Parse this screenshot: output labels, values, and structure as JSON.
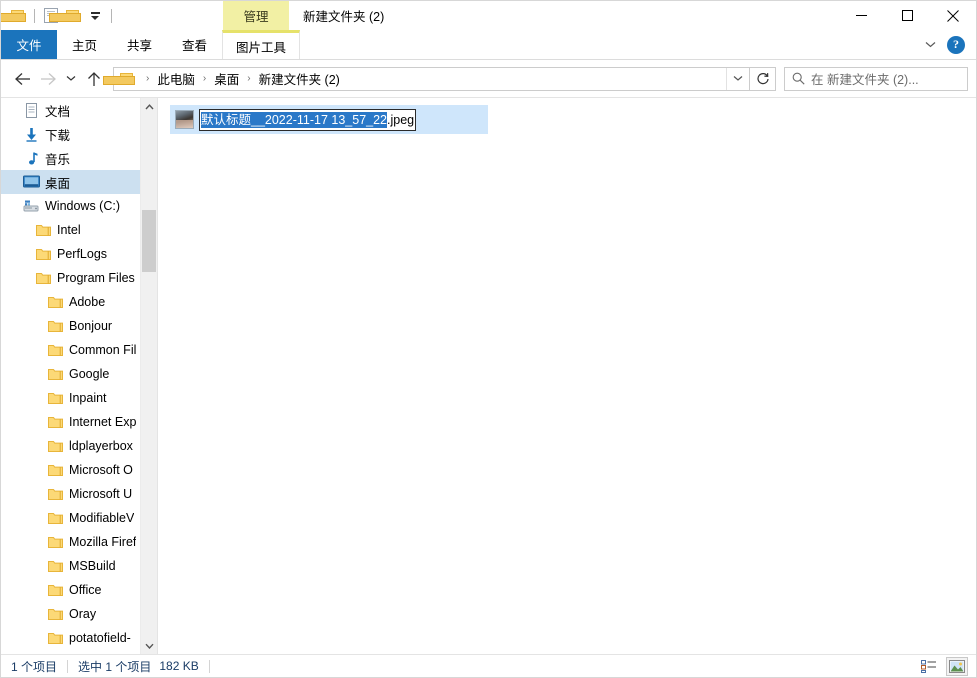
{
  "window": {
    "title": "新建文件夹 (2)",
    "contextual_tab_title": "管理",
    "contextual_tab_bg": "#f2f0a4",
    "accent": "#1b74bc",
    "controls": {
      "minimize": "minimize",
      "maximize": "maximize",
      "close": "close"
    }
  },
  "quick_access": {
    "items": [
      {
        "name": "folder-icon",
        "label": ""
      },
      {
        "name": "properties-icon",
        "label": ""
      },
      {
        "name": "new-folder-icon",
        "label": ""
      },
      {
        "name": "customize-caret",
        "label": ""
      }
    ]
  },
  "ribbon": {
    "tabs": [
      {
        "id": "file",
        "label": "文件",
        "active": true,
        "contextual": false
      },
      {
        "id": "home",
        "label": "主页",
        "active": false,
        "contextual": false
      },
      {
        "id": "share",
        "label": "共享",
        "active": false,
        "contextual": false
      },
      {
        "id": "view",
        "label": "查看",
        "active": false,
        "contextual": false
      },
      {
        "id": "picture-tools",
        "label": "图片工具",
        "active": false,
        "contextual": true
      }
    ],
    "collapse_icon": "chevron-down-icon",
    "help_label": "?"
  },
  "address_bar": {
    "back_icon": "arrow-left-icon",
    "forward_icon": "arrow-right-icon",
    "recent_icon": "chevron-down-icon",
    "up_icon": "arrow-up-icon",
    "breadcrumb": [
      {
        "label": "此电脑"
      },
      {
        "label": "桌面"
      },
      {
        "label": "新建文件夹 (2)"
      }
    ],
    "separator": "›",
    "dropdown_icon": "chevron-down-icon",
    "refresh_icon": "refresh-icon"
  },
  "search": {
    "icon": "search-icon",
    "placeholder": "在 新建文件夹 (2)..."
  },
  "nav_pane": {
    "scroll_up_icon": "chevron-up-icon",
    "scroll_down_icon": "chevron-down-icon",
    "items": [
      {
        "label": "文档",
        "icon": "documents-icon",
        "indent": 1,
        "selected": false
      },
      {
        "label": "下载",
        "icon": "downloads-icon",
        "indent": 1,
        "selected": false
      },
      {
        "label": "音乐",
        "icon": "music-icon",
        "indent": 1,
        "selected": false
      },
      {
        "label": "桌面",
        "icon": "desktop-icon",
        "indent": 1,
        "selected": true
      },
      {
        "label": "Windows (C:)",
        "icon": "drive-icon",
        "indent": 1,
        "selected": false
      },
      {
        "label": "Intel",
        "icon": "folder-icon",
        "indent": 2,
        "selected": false
      },
      {
        "label": "PerfLogs",
        "icon": "folder-icon",
        "indent": 2,
        "selected": false
      },
      {
        "label": "Program Files",
        "icon": "folder-icon",
        "indent": 2,
        "selected": false
      },
      {
        "label": "Adobe",
        "icon": "folder-icon",
        "indent": 3,
        "selected": false
      },
      {
        "label": "Bonjour",
        "icon": "folder-icon",
        "indent": 3,
        "selected": false
      },
      {
        "label": "Common Fil",
        "icon": "folder-icon",
        "indent": 3,
        "selected": false
      },
      {
        "label": "Google",
        "icon": "folder-icon",
        "indent": 3,
        "selected": false
      },
      {
        "label": "Inpaint",
        "icon": "folder-icon",
        "indent": 3,
        "selected": false
      },
      {
        "label": "Internet Exp",
        "icon": "folder-icon",
        "indent": 3,
        "selected": false
      },
      {
        "label": "ldplayerbox",
        "icon": "folder-icon",
        "indent": 3,
        "selected": false
      },
      {
        "label": "Microsoft O",
        "icon": "folder-icon",
        "indent": 3,
        "selected": false
      },
      {
        "label": "Microsoft U",
        "icon": "folder-icon",
        "indent": 3,
        "selected": false
      },
      {
        "label": "ModifiableV",
        "icon": "folder-icon",
        "indent": 3,
        "selected": false
      },
      {
        "label": "Mozilla Firef",
        "icon": "folder-icon",
        "indent": 3,
        "selected": false
      },
      {
        "label": "MSBuild",
        "icon": "folder-icon",
        "indent": 3,
        "selected": false
      },
      {
        "label": "Office",
        "icon": "folder-icon",
        "indent": 3,
        "selected": false
      },
      {
        "label": "Oray",
        "icon": "folder-icon",
        "indent": 3,
        "selected": false
      },
      {
        "label": "potatofield-",
        "icon": "folder-icon",
        "indent": 3,
        "selected": false
      },
      {
        "label": "",
        "icon": "folder-icon",
        "indent": 3,
        "selected": false
      }
    ]
  },
  "file_list": {
    "item": {
      "thumbnail": "photo-thumbnail",
      "name_selected": "默认标题__2022-11-17 13_57_22",
      "name_extension": ".jpeg",
      "renaming": true
    }
  },
  "status_bar": {
    "item_count": "1 个项目",
    "selection": "选中 1 个项目",
    "size": "182 KB",
    "views": [
      {
        "id": "details",
        "icon": "details-view-icon",
        "active": false
      },
      {
        "id": "large-icons",
        "icon": "large-icons-view-icon",
        "active": true
      }
    ]
  }
}
